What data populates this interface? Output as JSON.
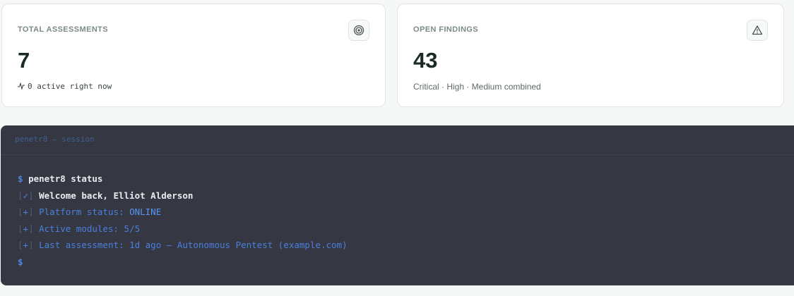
{
  "cards": [
    {
      "label": "TOTAL ASSESSMENTS",
      "value": "7",
      "sub": "0 active right now",
      "icon": "target-icon",
      "sub_icon": "activity-icon"
    },
    {
      "label": "OPEN FINDINGS",
      "value": "43",
      "sub": "Critical · High · Medium combined",
      "icon": "warning-icon"
    }
  ],
  "terminal": {
    "title": "penetr8 — session",
    "prompt": "$",
    "command": "penetr8 status",
    "welcome_mark": "✓",
    "welcome": "Welcome back, Elliot Alderson",
    "plus_mark": "+",
    "status_label": "Platform status: ",
    "status_value": "ONLINE",
    "modules_label": "Active modules: ",
    "modules_value": "5/5",
    "last_label": "Last assessment: ",
    "last_value": "1d ago — Autonomous Pentest (example.com)"
  },
  "colors": {
    "terminal_bg": "#363943",
    "accent_blue": "#4b7fde",
    "page_bg": "#f6f7f7"
  }
}
